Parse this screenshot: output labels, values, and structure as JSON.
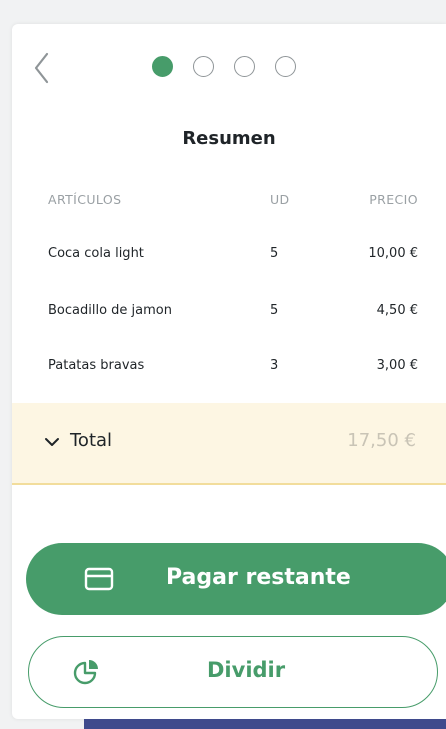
{
  "header": {
    "step_count": 4,
    "active_step": 1
  },
  "summary": {
    "title": "Resumen",
    "columns": {
      "item": "ARTÍCULOS",
      "qty": "UD",
      "price": "PRECIO"
    },
    "rows": [
      {
        "name": "Coca cola light",
        "qty": "5",
        "price": "10,00 €"
      },
      {
        "name": "Bocadillo de jamon",
        "qty": "5",
        "price": "4,50 €"
      },
      {
        "name": "Patatas bravas",
        "qty": "3",
        "price": "3,00 €"
      }
    ],
    "total_label": "Total",
    "total_value": "17,50 €"
  },
  "actions": {
    "pay_label": "Pagar restante",
    "split_label": "Dividir"
  },
  "colors": {
    "accent": "#479c6a",
    "total_bg": "#fdf6e3",
    "total_border": "#f2dd9c"
  }
}
